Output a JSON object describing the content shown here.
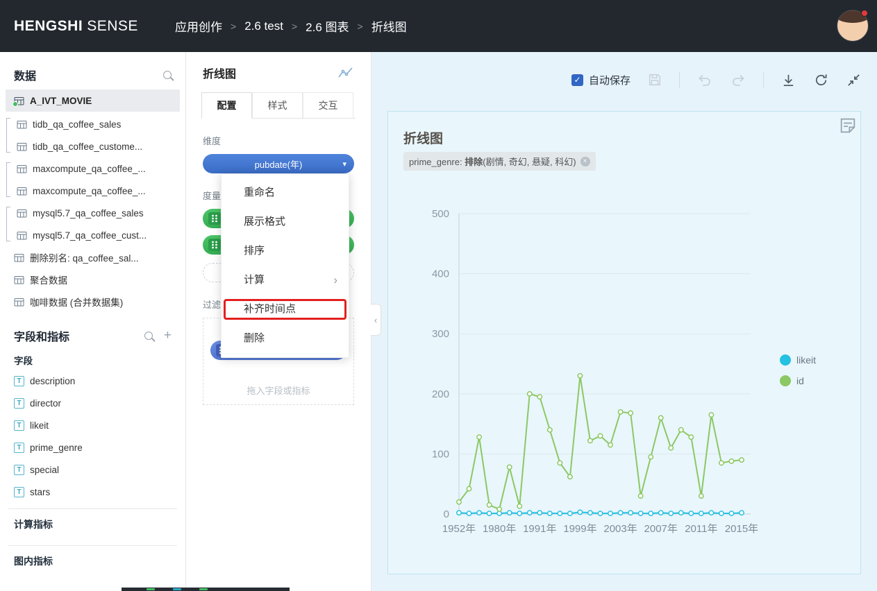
{
  "icons": {
    "chevron_down": "▾",
    "submenu_arrow": "›",
    "collapse_left": "‹",
    "plus": "+",
    "close": "×",
    "check": "✓",
    "field_type_text": "T"
  },
  "topbar": {
    "logo_bold": "HENGSHI",
    "logo_light": "SENSE",
    "breadcrumb": [
      "应用创作",
      "2.6 test",
      "2.6 图表",
      "折线图"
    ],
    "breadcrumb_separator": ">"
  },
  "sidebar": {
    "data_title": "数据",
    "selected_dataset": "A_IVT_MOVIE",
    "table_groups": [
      {
        "bracket": true,
        "items": [
          "tidb_qa_coffee_sales",
          "tidb_qa_coffee_custome..."
        ]
      },
      {
        "bracket": true,
        "items": [
          "maxcompute_qa_coffee_...",
          "maxcompute_qa_coffee_..."
        ]
      },
      {
        "bracket": true,
        "items": [
          "mysql5.7_qa_coffee_sales",
          "mysql5.7_qa_coffee_cust..."
        ]
      },
      {
        "bracket": false,
        "items": [
          "删除别名: qa_coffee_sal...",
          "聚合数据",
          "咖啡数据 (合并数据集)"
        ]
      }
    ],
    "fields_header": "字段和指标",
    "fields_subheader": "字段",
    "fields": [
      "description",
      "director",
      "likeit",
      "prime_genre",
      "special",
      "stars"
    ],
    "calc_metrics_header": "计算指标",
    "chart_metrics_header": "图内指标"
  },
  "config_panel": {
    "title": "折线图",
    "tabs": [
      "配置",
      "样式",
      "交互"
    ],
    "active_tab": "配置",
    "dimension_label": "维度",
    "dimension_value": "pubdate(年)",
    "measure_label": "度量",
    "filter_label": "过滤器",
    "filter_placeholder": "拖入字段或指标"
  },
  "context_menu": {
    "items": [
      {
        "label": "重命名",
        "submenu": false,
        "highlighted": false
      },
      {
        "label": "展示格式",
        "submenu": false,
        "highlighted": false
      },
      {
        "label": "排序",
        "submenu": false,
        "highlighted": false
      },
      {
        "label": "计算",
        "submenu": true,
        "highlighted": false
      },
      {
        "label": "补齐时间点",
        "submenu": false,
        "highlighted": true
      },
      {
        "label": "删除",
        "submenu": false,
        "highlighted": false
      }
    ]
  },
  "canvas": {
    "autosave_label": "自动保存",
    "autosave_checked": true,
    "card_title": "折线图",
    "filter_tag": {
      "prefix": "prime_genre: ",
      "emphasis": "排除",
      "suffix": "(剧情, 奇幻, 悬疑, 科幻)"
    }
  },
  "colors": {
    "accent_blue": "#4377d2",
    "measure_green": "#3fbc5e",
    "filter_blue": "#5e80d8",
    "highlight_red": "#e42020",
    "line_green": "#8cc863",
    "line_cyan": "#25c0e2",
    "canvas_bg": "#e7f3fa"
  },
  "chart_data": {
    "type": "line",
    "title": "折线图",
    "n_points": 29,
    "x_ticks": [
      {
        "index": 0,
        "label": "1952年"
      },
      {
        "index": 4,
        "label": "1980年"
      },
      {
        "index": 8,
        "label": "1991年"
      },
      {
        "index": 12,
        "label": "1999年"
      },
      {
        "index": 16,
        "label": "2003年"
      },
      {
        "index": 20,
        "label": "2007年"
      },
      {
        "index": 24,
        "label": "2011年"
      },
      {
        "index": 28,
        "label": "2015年"
      }
    ],
    "ylim": [
      0,
      500
    ],
    "yticks": [
      0,
      100,
      200,
      300,
      400,
      500
    ],
    "grid": true,
    "legend_position": "right",
    "series": [
      {
        "name": "likeit",
        "color": "#25c0e2",
        "values": [
          2,
          1,
          2,
          1,
          1,
          2,
          1,
          2,
          2,
          1,
          1,
          1,
          3,
          2,
          1,
          1,
          2,
          2,
          1,
          1,
          2,
          1,
          2,
          1,
          1,
          2,
          1,
          1,
          2
        ]
      },
      {
        "name": "id",
        "color": "#8cc863",
        "values": [
          20,
          42,
          128,
          15,
          8,
          78,
          13,
          200,
          195,
          140,
          85,
          62,
          230,
          122,
          130,
          115,
          170,
          168,
          30,
          95,
          160,
          110,
          140,
          128,
          30,
          165,
          85,
          88,
          90
        ]
      }
    ]
  }
}
